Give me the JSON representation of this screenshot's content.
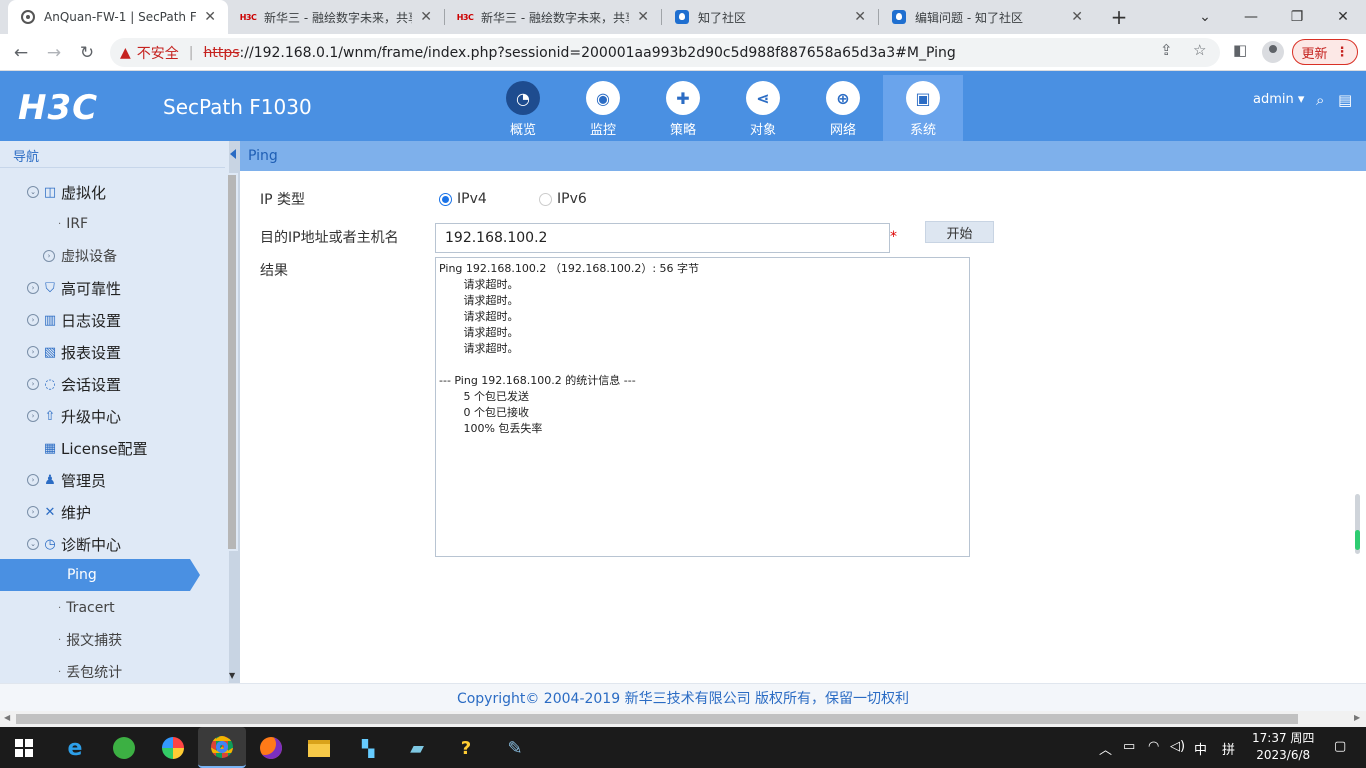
{
  "browser": {
    "tabs": [
      {
        "title": "AnQuan-FW-1 | SecPath F1",
        "favicon": "chrome-icon",
        "active": true
      },
      {
        "title": "新华三 - 融绘数字未来，共享",
        "favicon": "h3c-icon"
      },
      {
        "title": "新华三 - 融绘数字未来，共享",
        "favicon": "h3c-icon"
      },
      {
        "title": "知了社区",
        "favicon": "zhiliao-icon"
      },
      {
        "title": "编辑问题 - 知了社区",
        "favicon": "zhiliao-icon"
      }
    ],
    "new_tab": "+",
    "window_controls": {
      "dropdown": "⌄",
      "minimize": "—",
      "restore": "❐",
      "close": "✕"
    },
    "insecure_label": "不安全",
    "url_scheme": "https",
    "url_rest": "://192.168.0.1/wnm/frame/index.php?sessionid=200001aa993b2d90c5d988f887658a65d3a3#M_Ping",
    "update_label": "更新"
  },
  "header": {
    "logo": "H3C",
    "product": "SecPath F1030",
    "modules": [
      {
        "label": "概览",
        "icon": "gauge-icon"
      },
      {
        "label": "监控",
        "icon": "camera-icon"
      },
      {
        "label": "策略",
        "icon": "shield-icon"
      },
      {
        "label": "对象",
        "icon": "share-icon"
      },
      {
        "label": "网络",
        "icon": "globe-icon"
      },
      {
        "label": "系统",
        "icon": "monitor-icon",
        "active": true
      }
    ],
    "user": "admin"
  },
  "sidebar": {
    "title": "导航",
    "items": [
      {
        "label": "虚拟化",
        "icon": "virtual-icon",
        "level": 1
      },
      {
        "label": "IRF",
        "level": 2
      },
      {
        "label": "虚拟设备",
        "level": 2
      },
      {
        "label": "高可靠性",
        "icon": "shield-icon",
        "level": 1
      },
      {
        "label": "日志设置",
        "icon": "log-icon",
        "level": 1
      },
      {
        "label": "报表设置",
        "icon": "report-icon",
        "level": 1
      },
      {
        "label": "会话设置",
        "icon": "session-icon",
        "level": 1
      },
      {
        "label": "升级中心",
        "icon": "upgrade-icon",
        "level": 1
      },
      {
        "label": "License配置",
        "icon": "license-icon",
        "level": 1
      },
      {
        "label": "管理员",
        "icon": "admin-icon",
        "level": 1
      },
      {
        "label": "维护",
        "icon": "tools-icon",
        "level": 1
      },
      {
        "label": "诊断中心",
        "icon": "diagnose-icon",
        "level": 1
      },
      {
        "label": "Ping",
        "level": 2,
        "active": true
      },
      {
        "label": "Tracert",
        "level": 2
      },
      {
        "label": "报文捕获",
        "level": 2
      },
      {
        "label": "丢包统计",
        "level": 2
      }
    ]
  },
  "content": {
    "title": "Ping",
    "ip_type_label": "IP 类型",
    "ipv4_label": "IPv4",
    "ipv6_label": "IPv6",
    "dest_label": "目的IP地址或者主机名",
    "dest_value": "192.168.100.2",
    "required_mark": "*",
    "start_label": "开始",
    "result_label": "结果",
    "result_text": "Ping 192.168.100.2 （192.168.100.2）: 56 字节\n       请求超时。\n       请求超时。\n       请求超时。\n       请求超时。\n       请求超时。\n\n--- Ping 192.168.100.2 的统计信息 ---\n       5 个包已发送\n       0 个包已接收\n       100% 包丢失率"
  },
  "footer": {
    "copyright": "Copyright© 2004-2019 新华三技术有限公司 版权所有，保留一切权利"
  },
  "taskbar": {
    "ime": "中",
    "ime2": "拼",
    "time": "17:37 周四",
    "date": "2023/6/8"
  }
}
